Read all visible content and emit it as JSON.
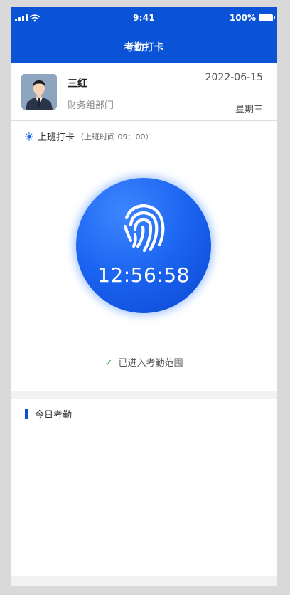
{
  "status_bar": {
    "time": "9:41",
    "battery": "100%"
  },
  "header": {
    "title": "考勤打卡"
  },
  "profile": {
    "name": "三红",
    "department": "财务组部门",
    "date": "2022-06-15",
    "weekday": "星期三"
  },
  "clock_in": {
    "label": "上班打卡",
    "shift_time": "（上班时间 09：00）",
    "time": "12:56:58",
    "range_status": "已进入考勤范围",
    "check_icon": "check-icon",
    "sun_icon": "sun-icon",
    "fingerprint_icon": "fingerprint-icon"
  },
  "today": {
    "title": "今日考勤"
  },
  "colors": {
    "primary": "#0a52d6",
    "success": "#2fae5a",
    "background": "#f2f2f2"
  }
}
